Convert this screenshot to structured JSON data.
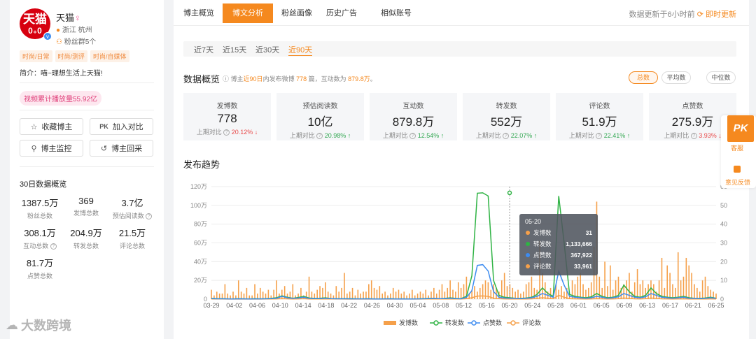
{
  "profile": {
    "avatar_line1": "天猫",
    "avatar_line2": "0₊0",
    "verified_mark": "v",
    "name": "天猫",
    "gender_symbol": "♀",
    "location": "浙江 杭州",
    "fan_groups": "粉丝群5个",
    "tags": [
      "时尚/日常",
      "时尚/测评",
      "时尚/自媒体"
    ],
    "intro": "简介：喵~理想生活上天猫!",
    "video_plays": "视频累计播放量55.92亿"
  },
  "actions": {
    "favorite": "收藏博主",
    "pk_icon": "PK",
    "compare": "加入对比",
    "monitor": "博主监控",
    "backtrack": "博主回采"
  },
  "stats30": {
    "title": "30日数据概览",
    "items": [
      {
        "value": "1387.5万",
        "label": "粉丝总数"
      },
      {
        "value": "369",
        "label": "发博总数"
      },
      {
        "value": "3.7亿",
        "label": "预估阅读数"
      },
      {
        "value": "308.1万",
        "label": "互动总数"
      },
      {
        "value": "204.9万",
        "label": "转发总数"
      },
      {
        "value": "21.5万",
        "label": "评论总数"
      },
      {
        "value": "81.7万",
        "label": "点赞总数"
      }
    ]
  },
  "nav": {
    "tabs": [
      "博主概览",
      "博文分析",
      "粉丝画像",
      "历史广告",
      "相似账号"
    ],
    "update_text": "数据更新于6小时前",
    "refresh": "即时更新"
  },
  "periods": [
    "近7天",
    "近15天",
    "近30天",
    "近90天"
  ],
  "overview": {
    "title": "数据概览",
    "sub_prefix": "博主",
    "sub_period": "近90日",
    "sub_mid": "内发布微博",
    "sub_count": "778",
    "sub_mid2": "篇，互动数为",
    "sub_interact": "879.8万",
    "sub_end": "。",
    "modes": [
      "总数",
      "平均数",
      "中位数"
    ]
  },
  "cards": [
    {
      "label": "发博数",
      "value": "778",
      "cmp": "上期对比",
      "pct": "20.12%",
      "dir": "down"
    },
    {
      "label": "预估阅读数",
      "value": "10亿",
      "cmp": "上期对比",
      "pct": "20.98%",
      "dir": "up"
    },
    {
      "label": "互动数",
      "value": "879.8万",
      "cmp": "上期对比",
      "pct": "12.54%",
      "dir": "up"
    },
    {
      "label": "转发数",
      "value": "552万",
      "cmp": "上期对比",
      "pct": "22.07%",
      "dir": "up"
    },
    {
      "label": "评论数",
      "value": "51.9万",
      "cmp": "上期对比",
      "pct": "22.41%",
      "dir": "up"
    },
    {
      "label": "点赞数",
      "value": "275.9万",
      "cmp": "上期对比",
      "pct": "3.93%",
      "dir": "down"
    }
  ],
  "trend_title": "发布趋势",
  "chart_data": {
    "type": "line",
    "title": "",
    "x": [
      "03-29",
      "04-02",
      "04-06",
      "04-10",
      "04-14",
      "04-18",
      "04-22",
      "04-26",
      "04-30",
      "05-04",
      "05-08",
      "05-12",
      "05-16",
      "05-20",
      "05-24",
      "05-28",
      "06-01",
      "06-05",
      "06-09",
      "06-13",
      "06-17",
      "06-21",
      "06-25"
    ],
    "x_ticks": [
      "03-29",
      "04-02",
      "04-06",
      "04-10",
      "04-14",
      "04-18",
      "04-22",
      "04-26",
      "04-30",
      "05-04",
      "05-08",
      "05-12",
      "05-16",
      "05-20",
      "05-24",
      "05-28",
      "06-01",
      "06-05",
      "06-09",
      "06-13",
      "06-17",
      "06-21",
      "06-25"
    ],
    "y_left_ticks": [
      "0",
      "20万",
      "40万",
      "60万",
      "80万",
      "100万",
      "120万"
    ],
    "y_left_lim": [
      0,
      1200000
    ],
    "y_right_ticks": [
      "0",
      "10",
      "20",
      "30",
      "40",
      "50",
      "60"
    ],
    "y_right_lim": [
      0,
      60
    ],
    "series": [
      {
        "name": "发博数",
        "kind": "bar",
        "axis": "right",
        "color": "#f5a04a",
        "values": [
          5,
          2,
          4,
          3,
          3,
          8,
          3,
          2,
          4,
          2,
          10,
          4,
          3,
          6,
          2,
          2,
          8,
          3,
          6,
          4,
          3,
          5,
          2,
          5,
          10,
          3,
          5,
          7,
          3,
          4,
          8,
          2,
          3,
          6,
          2,
          4,
          12,
          4,
          3,
          5,
          7,
          6,
          9,
          4,
          3,
          2,
          7,
          4,
          6,
          14,
          3,
          4,
          6,
          2,
          5,
          3,
          4,
          4,
          8,
          10,
          6,
          5,
          7,
          3,
          4,
          2,
          3,
          6,
          4,
          5,
          3,
          4,
          2,
          3,
          5,
          2,
          3,
          4,
          3,
          5,
          2,
          4,
          6,
          3,
          5,
          8,
          4,
          6,
          10,
          5,
          4,
          9,
          6,
          8,
          12,
          3,
          5,
          7,
          4,
          6,
          8,
          10,
          9,
          5,
          8,
          6,
          4,
          10,
          14,
          7,
          8,
          6,
          4,
          5,
          3,
          4,
          8,
          9,
          12,
          6,
          5,
          31,
          14,
          9,
          4,
          6,
          3,
          8,
          5,
          7,
          4,
          6,
          2,
          10,
          8,
          12,
          14,
          8,
          5,
          6,
          9,
          28,
          52,
          12,
          6,
          20,
          7,
          18,
          5,
          10,
          12,
          6,
          8,
          10,
          14,
          4,
          9,
          16,
          8,
          10,
          6,
          8,
          10,
          8,
          4,
          10,
          22,
          6,
          18,
          14,
          8,
          6,
          25,
          10,
          12,
          22,
          18,
          14,
          8,
          6,
          4,
          10,
          12,
          7,
          5,
          4,
          3
        ]
      },
      {
        "name": "转发数",
        "kind": "line",
        "axis": "left",
        "color": "#2fb344",
        "values": [
          8000,
          5000,
          6000,
          4000,
          3000,
          5000,
          4000,
          3000,
          5000,
          4000,
          6000,
          8000,
          15000,
          35000,
          20000,
          10000,
          18000,
          30000,
          12000,
          8000,
          9000,
          14000,
          7000,
          6000,
          6000,
          5000,
          5000,
          4000,
          4000,
          5000,
          3000,
          3000,
          4000,
          5000,
          3000,
          4000,
          3000,
          3000,
          4000,
          6000,
          8000,
          10000,
          6000,
          8000,
          14000,
          8000,
          6000,
          30000,
          250000,
          1130000,
          1133666,
          1100000,
          200000,
          40000,
          20000,
          15000,
          10000,
          8000,
          12000,
          20000,
          50000,
          120000,
          60000,
          30000,
          1100000,
          600000,
          50000,
          30000,
          20000,
          15000,
          25000,
          60000,
          30000,
          15000,
          20000,
          40000,
          150000,
          80000,
          30000,
          20000,
          40000,
          120000,
          60000,
          30000,
          20000,
          15000,
          20000,
          30000,
          15000,
          10000,
          8000,
          12000,
          20000,
          10000
        ]
      },
      {
        "name": "点赞数",
        "kind": "line",
        "axis": "left",
        "color": "#3d8cf0",
        "values": [
          5000,
          4000,
          4000,
          3000,
          2000,
          4000,
          3000,
          2000,
          3000,
          3000,
          4000,
          5000,
          10000,
          30000,
          15000,
          8000,
          12000,
          20000,
          8000,
          6000,
          6000,
          10000,
          5000,
          4000,
          4000,
          4000,
          3000,
          3000,
          3000,
          4000,
          2000,
          2000,
          3000,
          4000,
          2000,
          3000,
          2000,
          2000,
          3000,
          4000,
          6000,
          8000,
          5000,
          6000,
          10000,
          6000,
          4000,
          20000,
          90000,
          360000,
          367922,
          300000,
          80000,
          20000,
          12000,
          10000,
          8000,
          6000,
          10000,
          15000,
          30000,
          60000,
          40000,
          20000,
          300000,
          150000,
          30000,
          20000,
          15000,
          10000,
          15000,
          30000,
          20000,
          10000,
          15000,
          25000,
          60000,
          40000,
          20000,
          15000,
          25000,
          60000,
          40000,
          20000,
          15000,
          10000,
          15000,
          20000,
          10000,
          8000,
          6000,
          8000,
          15000,
          8000
        ]
      },
      {
        "name": "评论数",
        "kind": "line",
        "axis": "left",
        "color": "#f5a04a",
        "values": [
          2000,
          1500,
          1500,
          1000,
          1000,
          1500,
          1000,
          1000,
          1200,
          1000,
          1500,
          2000,
          3000,
          6000,
          4000,
          2000,
          3000,
          5000,
          2000,
          1500,
          1500,
          3000,
          1500,
          1200,
          1200,
          1000,
          1000,
          1000,
          1000,
          1200,
          800,
          800,
          1000,
          1200,
          800,
          1000,
          800,
          800,
          1000,
          1500,
          2000,
          2500,
          1500,
          2000,
          3000,
          2000,
          1500,
          5000,
          15000,
          33000,
          33961,
          30000,
          10000,
          5000,
          3000,
          2500,
          2000,
          1500,
          2500,
          4000,
          8000,
          15000,
          10000,
          5000,
          40000,
          20000,
          6000,
          4000,
          3000,
          2500,
          3000,
          6000,
          4000,
          2500,
          3000,
          5000,
          12000,
          8000,
          4000,
          3000,
          5000,
          12000,
          8000,
          4000,
          3000,
          2500,
          3000,
          4000,
          2500,
          2000,
          1500,
          2000,
          3000,
          2000
        ]
      }
    ],
    "tooltip": {
      "date": "05-20",
      "rows": [
        {
          "name": "发博数",
          "value": "31",
          "color": "#f5a04a"
        },
        {
          "name": "转发数",
          "value": "1,133,666",
          "color": "#2fb344"
        },
        {
          "name": "点赞数",
          "value": "367,922",
          "color": "#3d8cf0"
        },
        {
          "name": "评论数",
          "value": "33,961",
          "color": "#f5a04a"
        }
      ]
    },
    "legend": [
      "发博数",
      "转发数",
      "点赞数",
      "评论数"
    ],
    "legend_position": "bottom"
  },
  "float_panel": {
    "pk": "PK",
    "pk_label": "客服",
    "feedback": "意见反馈"
  },
  "watermark": "大数跨境"
}
